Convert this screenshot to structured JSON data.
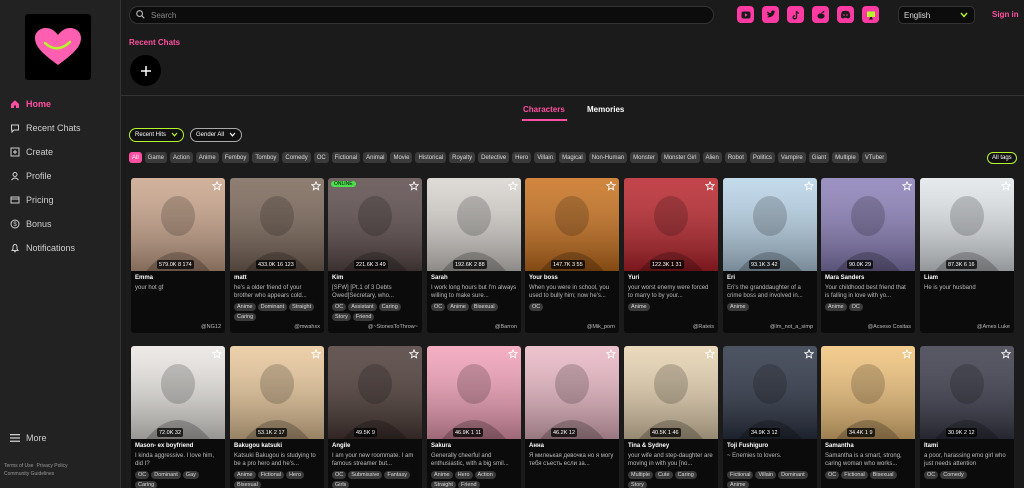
{
  "brand": {
    "accent": "#ff4fa0",
    "highlight": "#b7f52c"
  },
  "sidebar": {
    "items": [
      {
        "label": "Home",
        "icon": "home-icon",
        "active": true
      },
      {
        "label": "Recent Chats",
        "icon": "chat-bubble-icon",
        "active": false
      },
      {
        "label": "Create",
        "icon": "plus-square-icon",
        "active": false
      },
      {
        "label": "Profile",
        "icon": "user-icon",
        "active": false
      },
      {
        "label": "Pricing",
        "icon": "card-icon",
        "active": false
      },
      {
        "label": "Bonus",
        "icon": "dollar-icon",
        "active": false
      },
      {
        "label": "Notifications",
        "icon": "bell-icon",
        "active": false
      }
    ],
    "more_label": "More",
    "footer": {
      "terms": "Terms of Use",
      "privacy": "Privacy Policy",
      "guidelines": "Community Guidelines"
    }
  },
  "header": {
    "search_placeholder": "Search",
    "socials": [
      "youtube-icon",
      "twitter-icon",
      "tiktok-icon",
      "reddit-icon",
      "discord-icon",
      "monitor-icon"
    ],
    "language": "English",
    "signin": "Sign in"
  },
  "recent_chats": {
    "title": "Recent Chats"
  },
  "tabs": [
    {
      "label": "Characters",
      "active": true
    },
    {
      "label": "Memories",
      "active": false
    }
  ],
  "filters": {
    "sort": "Recent Hits",
    "gender": "Gender All",
    "all_tags": "All tags",
    "tags": [
      "All",
      "Game",
      "Action",
      "Anime",
      "Femboy",
      "Tomboy",
      "Comedy",
      "OC",
      "Fictional",
      "Animal",
      "Movie",
      "Historical",
      "Royalty",
      "Detective",
      "Hero",
      "Villain",
      "Magical",
      "Non-Human",
      "Monster",
      "Monster Girl",
      "Alien",
      "Robot",
      "Politics",
      "Vampire",
      "Giant",
      "Multiple",
      "VTuber"
    ]
  },
  "cards": [
    {
      "name": "Emma",
      "desc": "your hot gf",
      "stats": "579.0K  8  174",
      "tags": [],
      "author": "@NG12",
      "color": "#c9a48a"
    },
    {
      "name": "matt",
      "desc": "he's a older friend of your brother who appears cold...",
      "stats": "433.0K  16  123",
      "tags": [
        "Anime",
        "Dominant",
        "Straight",
        "Caring"
      ],
      "author": "@mwahxx",
      "color": "#7a6658"
    },
    {
      "name": "Kim",
      "desc": "[SFW] [Pt.1 of 3 Debts Owed]Secretary, who...",
      "stats": "221.6K  3  49",
      "tags": [
        "OC",
        "Assistant",
        "Caring",
        "Story",
        "Friend"
      ],
      "author": "@~StonesToThrow~",
      "color": "#5b4a4a",
      "badge": "ONLINE"
    },
    {
      "name": "Sarah",
      "desc": "I work long hours but I'm always willing to make sure...",
      "stats": "192.6K  2  88",
      "tags": [
        "OC",
        "Anime",
        "Bisexual"
      ],
      "author": "@Barron",
      "color": "#d8d4cf"
    },
    {
      "name": "Your boss",
      "desc": "When you were in school, you used to bully him; now he's...",
      "stats": "147.7K  3  55",
      "tags": [
        "OC"
      ],
      "author": "@Mik_porn",
      "color": "#c8701c"
    },
    {
      "name": "Yuri",
      "desc": "your worst enemy were forced to marry to by your...",
      "stats": "122.3K  1  31",
      "tags": [
        "Anime"
      ],
      "author": "@Rateis",
      "color": "#b8232a"
    },
    {
      "name": "Eri",
      "desc": "Eri's the granddaughter of a crime boss and involved in...",
      "stats": "93.1K  3  42",
      "tags": [
        "Anime"
      ],
      "author": "@Im_not_a_simp",
      "color": "#b9d4e8"
    },
    {
      "name": "Mara Sanders",
      "desc": "Your childhood best friend that is falling in love with yo...",
      "stats": "90.0K  29",
      "tags": [
        "Anime",
        "OC"
      ],
      "author": "@Acseso Cositas",
      "color": "#8a7fb8"
    },
    {
      "name": "Liam",
      "desc": "He is your husband",
      "stats": "87.3K  6  16",
      "tags": [],
      "author": "@Ames Luke",
      "color": "#e2e6ea"
    },
    {
      "name": "Mason- ex boyfriend",
      "desc": "I kinda aggressive. I love him, did I?",
      "stats": "72.0K  32",
      "tags": [
        "OC",
        "Dominant",
        "Gay",
        "Caring"
      ],
      "author": "",
      "color": "#e9e6e2"
    },
    {
      "name": "Bakugou katsuki",
      "desc": "Katsuki Bakugou is studying to be a pro hero and he's...",
      "stats": "53.1K  2  17",
      "tags": [
        "Anime",
        "Fictional",
        "Hero",
        "Bisexual"
      ],
      "author": "",
      "color": "#e8c79a"
    },
    {
      "name": "Angile",
      "desc": "I am your new roommate. I am famous streamer but...",
      "stats": "49.5K  9",
      "tags": [
        "OC",
        "Submissive",
        "Fantasy",
        "Girls"
      ],
      "author": "",
      "color": "#4b3a36"
    },
    {
      "name": "Sakura",
      "desc": "Generally cheerful and enthusiastic, with a big smil...",
      "stats": "46.9K  1  11",
      "tags": [
        "Anime",
        "Hero",
        "Action",
        "Straight",
        "Friend"
      ],
      "author": "",
      "color": "#f2a0b8"
    },
    {
      "name": "Анна",
      "desc": "Я милеькая девочка но я могу тебя съесть если за...",
      "stats": "46.2K  12",
      "tags": [],
      "author": "",
      "color": "#e9b7c4"
    },
    {
      "name": "Tina & Sydney",
      "desc": "your wife and step-daughter are moving in with you [no...",
      "stats": "40.5K  1  46",
      "tags": [
        "Multiple",
        "Cute",
        "Caring",
        "Story"
      ],
      "author": "",
      "color": "#e6d2b0"
    },
    {
      "name": "Toji Fushiguro",
      "desc": "~ Enemies to lovers.",
      "stats": "34.9K  3  12",
      "tags": [
        "Fictional",
        "Villain",
        "Dominant",
        "Anime"
      ],
      "author": "",
      "color": "#2b3344"
    },
    {
      "name": "Samantha",
      "desc": "Samantha is a smart, strong, caring woman who works...",
      "stats": "34.4K  1  9",
      "tags": [
        "OC",
        "Fictional",
        "Bisexual"
      ],
      "author": "",
      "color": "#f0c27a"
    },
    {
      "name": "Itami",
      "desc": "a poor, harassing emo girl who just needs attention",
      "stats": "30.9K  2  12",
      "tags": [
        "OC",
        "Comedy"
      ],
      "author": "",
      "color": "#3a3a4a"
    }
  ]
}
